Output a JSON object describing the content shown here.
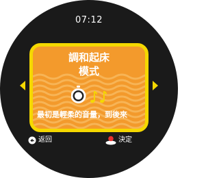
{
  "status": {
    "time": "07:12"
  },
  "mode_card": {
    "title_line1": "調和起床",
    "title_line2": "模式",
    "description": "最初是輕柔的音量，到後來",
    "icon": "alarm-clock-with-music-notes-icon",
    "colors": {
      "card_background": "#f39a2c",
      "card_border": "#f5d800",
      "waves": "#f7b456"
    }
  },
  "navigation": {
    "prev_icon": "arrow-left-icon",
    "next_icon": "arrow-right-icon"
  },
  "footer": {
    "back_label": "返回",
    "back_icon": "back-button-icon",
    "confirm_label": "決定",
    "confirm_icon": "confirm-button-icon"
  }
}
